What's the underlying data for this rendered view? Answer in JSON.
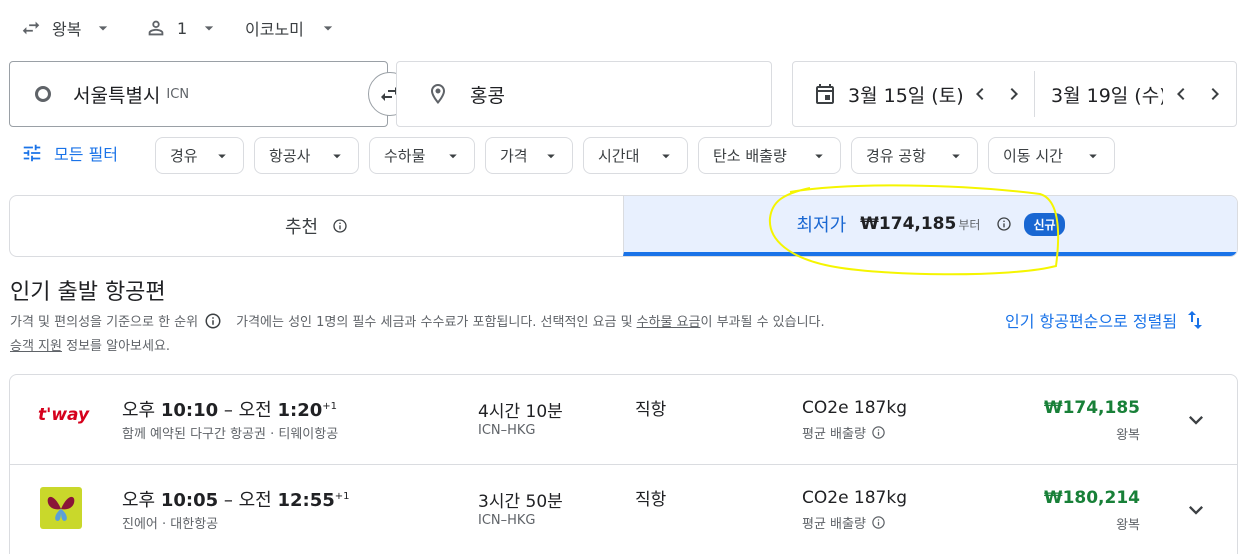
{
  "trip_options": {
    "trip_type": "왕복",
    "passengers": "1",
    "cabin": "이코노미"
  },
  "search": {
    "origin_city": "서울특별시",
    "origin_code": "ICN",
    "destination": "홍콩",
    "depart_date": "3월 15일 (토)",
    "return_date": "3월 19일 (수)"
  },
  "filters": {
    "all_label": "모든 필터",
    "chips": [
      "경유",
      "항공사",
      "수하물",
      "가격",
      "시간대",
      "탄소 배출량",
      "경유 공항",
      "이동 시간"
    ]
  },
  "tabs": {
    "recommended": "추천",
    "cheapest": "최저가",
    "cheapest_price": "₩174,185",
    "cheapest_suffix": "부터",
    "new_badge": "신규"
  },
  "section": {
    "title": "인기 출발 항공편",
    "ranking_note": "가격 및 편의성을 기준으로 한 순위",
    "fee_note_prefix": "가격에는 성인 1명의 필수 세금과 수수료가 포함됩니다. 선택적인 요금 및",
    "fee_note_link": "수하물 요금",
    "fee_note_suffix": "이 부과될 수 있습니다.",
    "help_link": "승객 지원",
    "help_suffix": "정보를 알아보세요.",
    "sort_label": "인기 항공편순으로 정렬됨"
  },
  "flights": [
    {
      "time_prefix": "오후",
      "depart": "10:10",
      "arrival_prefix": "– 오전",
      "arrive": "1:20",
      "day_offset": "+1",
      "airline_note": "함께 예약된 다구간 항공권 · 티웨이항공",
      "logo_text": "t'way",
      "duration": "4시간 10분",
      "route": "ICN–HKG",
      "stops": "직항",
      "co2": "CO2e 187kg",
      "co2_note": "평균 배출량",
      "price": "₩174,185",
      "trip": "왕복"
    },
    {
      "time_prefix": "오후",
      "depart": "10:05",
      "arrival_prefix": "– 오전",
      "arrive": "12:55",
      "day_offset": "+1",
      "airline_note": "진에어 · 대한항공",
      "logo_text": "",
      "duration": "3시간 50분",
      "route": "ICN–HKG",
      "stops": "직항",
      "co2": "CO2e 187kg",
      "co2_note": "평균 배출량",
      "price": "₩180,214",
      "trip": "왕복"
    }
  ],
  "colors": {
    "accent": "#1a73e8",
    "price_green": "#188038",
    "highlight_annotation": "#f5f500"
  }
}
